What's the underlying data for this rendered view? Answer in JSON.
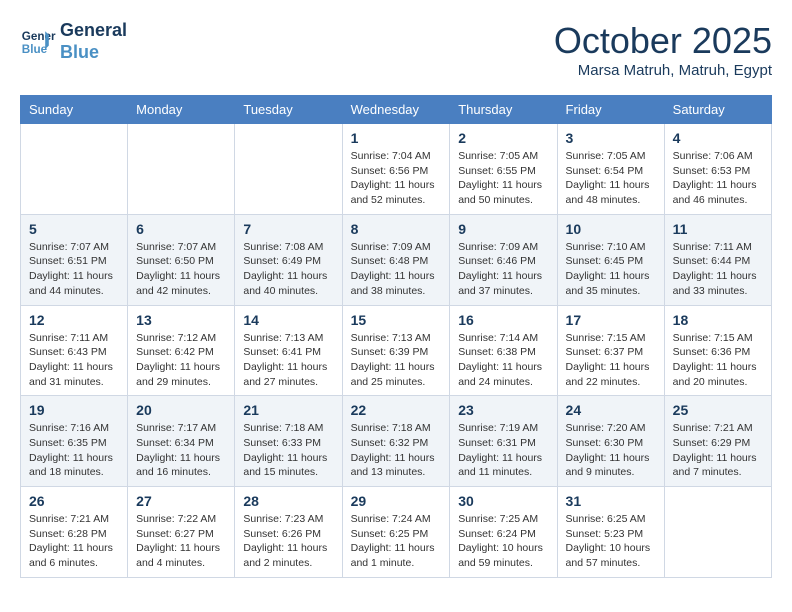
{
  "header": {
    "logo_line1": "General",
    "logo_line2": "Blue",
    "month": "October 2025",
    "location": "Marsa Matruh, Matruh, Egypt"
  },
  "weekdays": [
    "Sunday",
    "Monday",
    "Tuesday",
    "Wednesday",
    "Thursday",
    "Friday",
    "Saturday"
  ],
  "weeks": [
    [
      {
        "day": "",
        "info": ""
      },
      {
        "day": "",
        "info": ""
      },
      {
        "day": "",
        "info": ""
      },
      {
        "day": "1",
        "info": "Sunrise: 7:04 AM\nSunset: 6:56 PM\nDaylight: 11 hours\nand 52 minutes."
      },
      {
        "day": "2",
        "info": "Sunrise: 7:05 AM\nSunset: 6:55 PM\nDaylight: 11 hours\nand 50 minutes."
      },
      {
        "day": "3",
        "info": "Sunrise: 7:05 AM\nSunset: 6:54 PM\nDaylight: 11 hours\nand 48 minutes."
      },
      {
        "day": "4",
        "info": "Sunrise: 7:06 AM\nSunset: 6:53 PM\nDaylight: 11 hours\nand 46 minutes."
      }
    ],
    [
      {
        "day": "5",
        "info": "Sunrise: 7:07 AM\nSunset: 6:51 PM\nDaylight: 11 hours\nand 44 minutes."
      },
      {
        "day": "6",
        "info": "Sunrise: 7:07 AM\nSunset: 6:50 PM\nDaylight: 11 hours\nand 42 minutes."
      },
      {
        "day": "7",
        "info": "Sunrise: 7:08 AM\nSunset: 6:49 PM\nDaylight: 11 hours\nand 40 minutes."
      },
      {
        "day": "8",
        "info": "Sunrise: 7:09 AM\nSunset: 6:48 PM\nDaylight: 11 hours\nand 38 minutes."
      },
      {
        "day": "9",
        "info": "Sunrise: 7:09 AM\nSunset: 6:46 PM\nDaylight: 11 hours\nand 37 minutes."
      },
      {
        "day": "10",
        "info": "Sunrise: 7:10 AM\nSunset: 6:45 PM\nDaylight: 11 hours\nand 35 minutes."
      },
      {
        "day": "11",
        "info": "Sunrise: 7:11 AM\nSunset: 6:44 PM\nDaylight: 11 hours\nand 33 minutes."
      }
    ],
    [
      {
        "day": "12",
        "info": "Sunrise: 7:11 AM\nSunset: 6:43 PM\nDaylight: 11 hours\nand 31 minutes."
      },
      {
        "day": "13",
        "info": "Sunrise: 7:12 AM\nSunset: 6:42 PM\nDaylight: 11 hours\nand 29 minutes."
      },
      {
        "day": "14",
        "info": "Sunrise: 7:13 AM\nSunset: 6:41 PM\nDaylight: 11 hours\nand 27 minutes."
      },
      {
        "day": "15",
        "info": "Sunrise: 7:13 AM\nSunset: 6:39 PM\nDaylight: 11 hours\nand 25 minutes."
      },
      {
        "day": "16",
        "info": "Sunrise: 7:14 AM\nSunset: 6:38 PM\nDaylight: 11 hours\nand 24 minutes."
      },
      {
        "day": "17",
        "info": "Sunrise: 7:15 AM\nSunset: 6:37 PM\nDaylight: 11 hours\nand 22 minutes."
      },
      {
        "day": "18",
        "info": "Sunrise: 7:15 AM\nSunset: 6:36 PM\nDaylight: 11 hours\nand 20 minutes."
      }
    ],
    [
      {
        "day": "19",
        "info": "Sunrise: 7:16 AM\nSunset: 6:35 PM\nDaylight: 11 hours\nand 18 minutes."
      },
      {
        "day": "20",
        "info": "Sunrise: 7:17 AM\nSunset: 6:34 PM\nDaylight: 11 hours\nand 16 minutes."
      },
      {
        "day": "21",
        "info": "Sunrise: 7:18 AM\nSunset: 6:33 PM\nDaylight: 11 hours\nand 15 minutes."
      },
      {
        "day": "22",
        "info": "Sunrise: 7:18 AM\nSunset: 6:32 PM\nDaylight: 11 hours\nand 13 minutes."
      },
      {
        "day": "23",
        "info": "Sunrise: 7:19 AM\nSunset: 6:31 PM\nDaylight: 11 hours\nand 11 minutes."
      },
      {
        "day": "24",
        "info": "Sunrise: 7:20 AM\nSunset: 6:30 PM\nDaylight: 11 hours\nand 9 minutes."
      },
      {
        "day": "25",
        "info": "Sunrise: 7:21 AM\nSunset: 6:29 PM\nDaylight: 11 hours\nand 7 minutes."
      }
    ],
    [
      {
        "day": "26",
        "info": "Sunrise: 7:21 AM\nSunset: 6:28 PM\nDaylight: 11 hours\nand 6 minutes."
      },
      {
        "day": "27",
        "info": "Sunrise: 7:22 AM\nSunset: 6:27 PM\nDaylight: 11 hours\nand 4 minutes."
      },
      {
        "day": "28",
        "info": "Sunrise: 7:23 AM\nSunset: 6:26 PM\nDaylight: 11 hours\nand 2 minutes."
      },
      {
        "day": "29",
        "info": "Sunrise: 7:24 AM\nSunset: 6:25 PM\nDaylight: 11 hours\nand 1 minute."
      },
      {
        "day": "30",
        "info": "Sunrise: 7:25 AM\nSunset: 6:24 PM\nDaylight: 10 hours\nand 59 minutes."
      },
      {
        "day": "31",
        "info": "Sunrise: 6:25 AM\nSunset: 5:23 PM\nDaylight: 10 hours\nand 57 minutes."
      },
      {
        "day": "",
        "info": ""
      }
    ]
  ]
}
